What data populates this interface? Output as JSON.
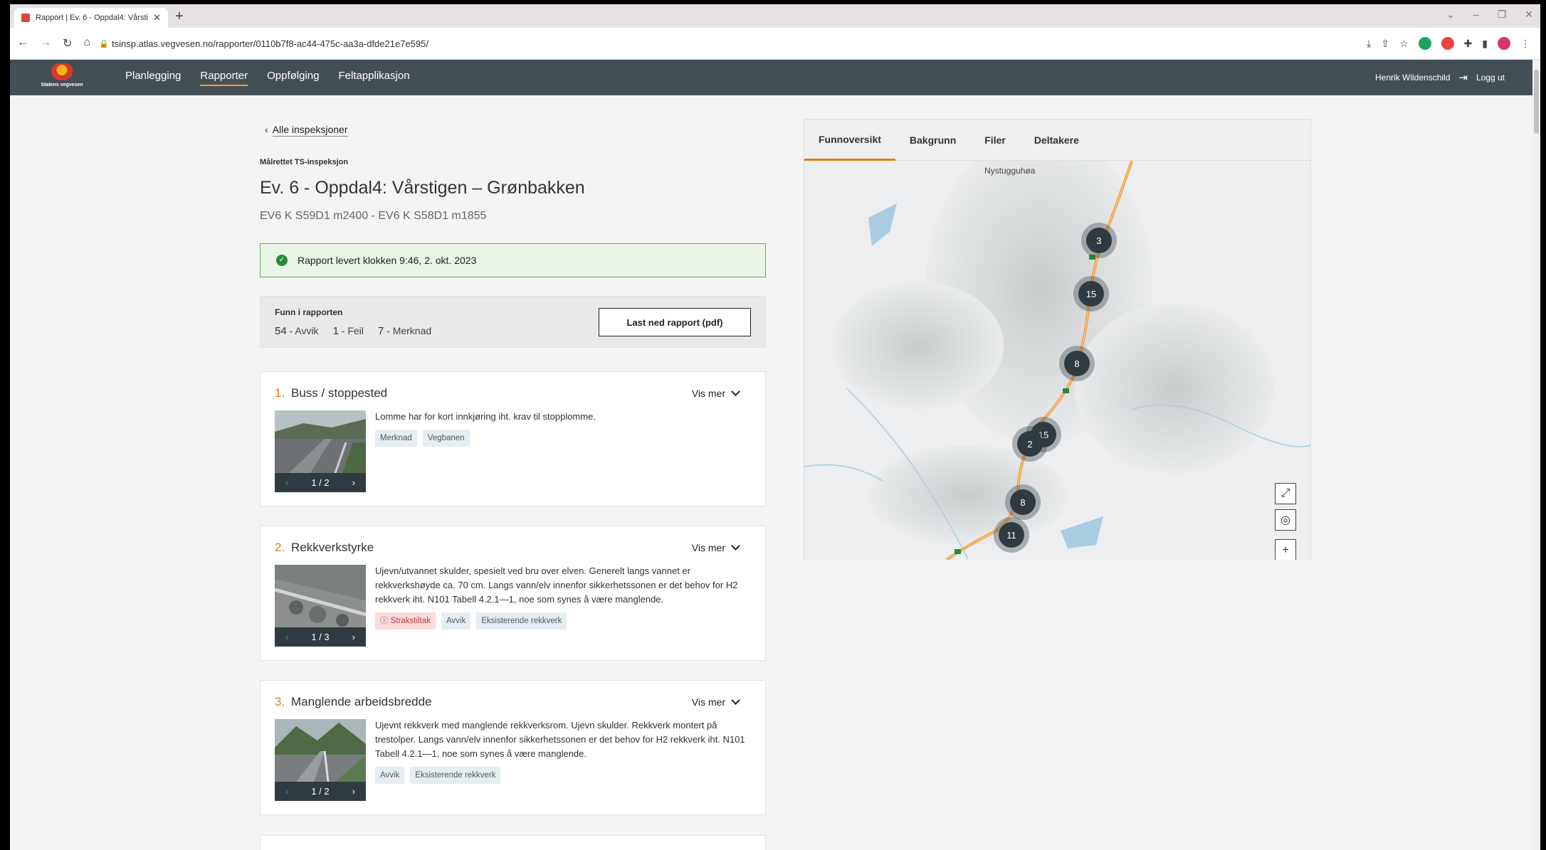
{
  "browser": {
    "tab_title": "Rapport | Ev. 6 - Oppdal4: Vårsti",
    "tab_close": "✕",
    "new_tab": "+",
    "url": "tsinsp.atlas.vegvesen.no/rapporter/0110b7f8-ac44-475c-aa3a-dfde21e7e595/"
  },
  "header": {
    "logo_text": "Statens vegvesen",
    "nav": [
      "Planlegging",
      "Rapporter",
      "Oppfølging",
      "Feltapplikasjon"
    ],
    "active_nav": "Rapporter",
    "user_name": "Henrik Wildenschild",
    "logout": "Logg ut"
  },
  "page": {
    "back_link": "Alle inspeksjoner",
    "kind": "Målrettet TS-inspeksjon",
    "title": "Ev. 6 - Oppdal4: Vårstigen – Grønbakken",
    "subtitle": "EV6 K S59D1 m2400 - EV6 K S58D1 m1855",
    "delivered": "Rapport levert klokken 9:46, 2. okt. 2023",
    "summary_label": "Funn i rapporten",
    "counts": [
      {
        "n": "54",
        "label": " - Avvik"
      },
      {
        "n": "1",
        "label": " - Feil"
      },
      {
        "n": "7",
        "label": " - Merknad"
      }
    ],
    "download": "Last ned rapport (pdf)",
    "vis_mer": "Vis mer"
  },
  "findings": [
    {
      "num": "1.",
      "title": "Buss / stoppested",
      "text": "Lomme har for kort innkjøring iht. krav til stopplomme.",
      "pager": "1 / 2",
      "tags": [
        "Merknad",
        "Vegbanen"
      ]
    },
    {
      "num": "2.",
      "title": "Rekkverkstyrke",
      "text": "Ujevn/utvannet skulder, spesielt ved bru over elven. Generelt langs vannet er rekkverkshøyde ca. 70 cm. Langs vann/elv innenfor sikkerhetssonen er det behov for H2 rekkverk iht. N101 Tabell 4.2.1—1, noe som synes å være manglende.",
      "pager": "1 / 3",
      "tags": [
        "Strakstiltak",
        "Avvik",
        "Eksisterende rekkverk"
      ]
    },
    {
      "num": "3.",
      "title": "Manglende arbeidsbredde",
      "text": "Ujevnt rekkverk med manglende rekkverksrom. Ujevn skulder. Rekkverk montert på trestolper. Langs vann/elv innenfor sikkerhetssonen er det behov for H2 rekkverk iht. N101 Tabell 4.2.1—1, noe som synes å være manglende.",
      "pager": "1 / 2",
      "tags": [
        "Avvik",
        "Eksisterende rekkverk"
      ]
    }
  ],
  "map": {
    "tabs": [
      "Funnoversikt",
      "Bakgrunn",
      "Filer",
      "Deltakere"
    ],
    "active_tab": "Funnoversikt",
    "place_label": "Nystugguhøa",
    "clusters": [
      "3",
      "15",
      "8",
      "15",
      "2",
      "8",
      "11"
    ],
    "zoom_in": "+",
    "zoom_out": "−"
  },
  "colors": {
    "header": "#444f55",
    "accent": "#e07b14",
    "success": "#2b8a3e",
    "route": "#f39c3d"
  }
}
